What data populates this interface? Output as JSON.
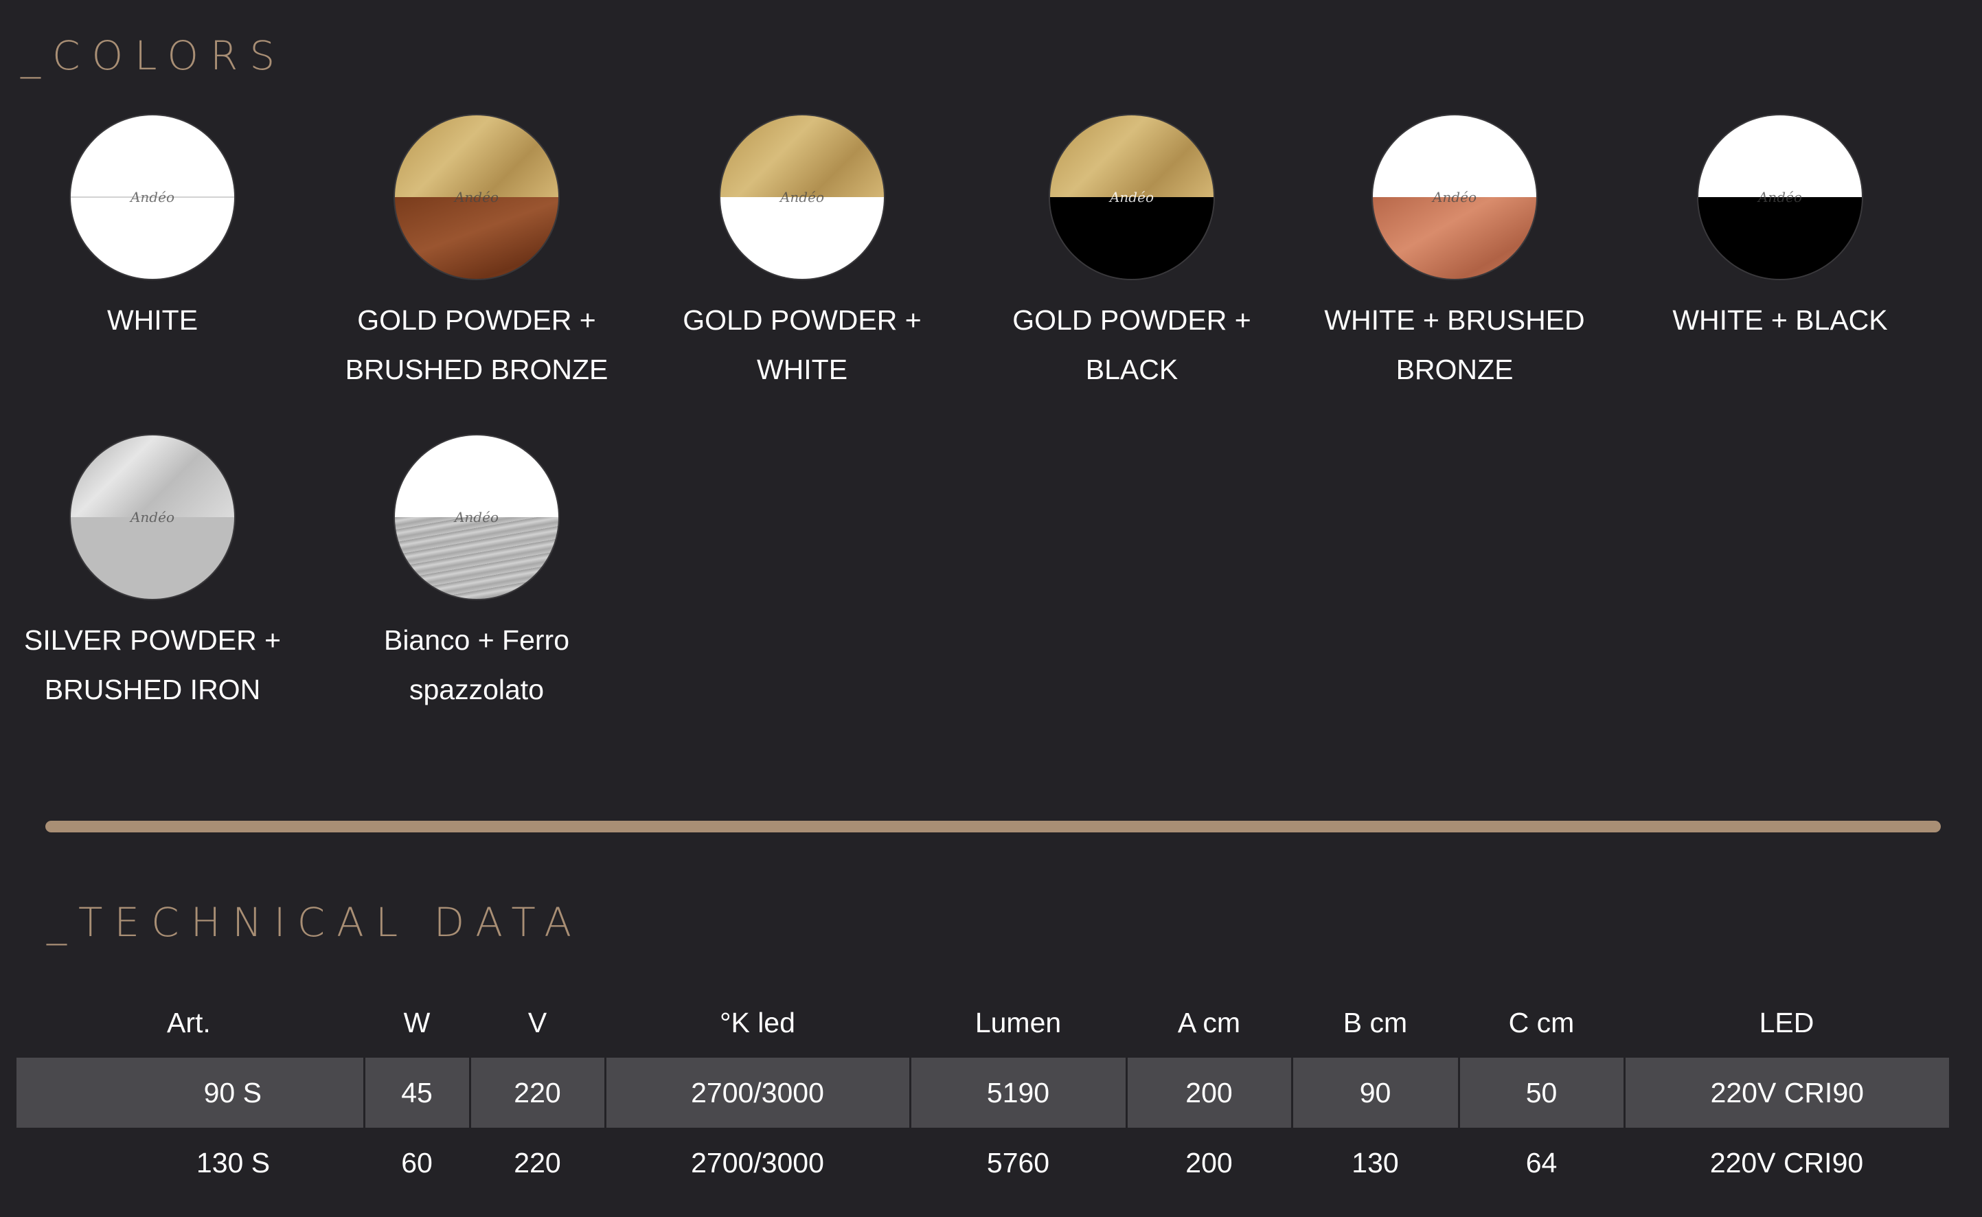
{
  "colors_section": {
    "title": "_COLORS",
    "swatches": [
      {
        "label": "WHITE",
        "brand": "Andéo",
        "top_color": "#ffffff",
        "bottom_color": "#ffffff"
      },
      {
        "label": "GOLD POWDER +\nBRUSHED BRONZE",
        "brand": "Andéo",
        "top_color": "#c8a866",
        "bottom_color": "#8a4a28"
      },
      {
        "label": "GOLD POWDER +\nWHITE",
        "brand": "Andéo",
        "top_color": "#c8a866",
        "bottom_color": "#ffffff"
      },
      {
        "label": "GOLD POWDER +\nBLACK",
        "brand": "Andéo",
        "top_color": "#c8a866",
        "bottom_color": "#000000"
      },
      {
        "label": "WHITE + BRUSHED\nBRONZE",
        "brand": "Andéo",
        "top_color": "#ffffff",
        "bottom_color": "#c8785a"
      },
      {
        "label": "WHITE +  BLACK",
        "brand": "Andéo",
        "top_color": "#ffffff",
        "bottom_color": "#000000"
      },
      {
        "label": "SILVER POWDER +\nBRUSHED IRON",
        "brand": "Andéo",
        "top_color": "#d0d0d0",
        "bottom_color": "#bdbdbd"
      },
      {
        "label": "Bianco + Ferro\nspazzolato",
        "brand": "Andéo",
        "top_color": "#ffffff",
        "bottom_color": "#b5b5b5"
      }
    ]
  },
  "technical_section": {
    "title": "_TECHNICAL DATA",
    "headers": [
      "Art.",
      "W",
      "V",
      "°K led",
      "Lumen",
      "A cm",
      "B cm",
      "C cm",
      "LED"
    ],
    "rows": [
      [
        "90 S",
        "45",
        "220",
        "2700/3000",
        "5190",
        "200",
        "90",
        "50",
        "220V CRI90"
      ],
      [
        "130 S",
        "60",
        "220",
        "2700/3000",
        "5760",
        "200",
        "130",
        "64",
        "220V CRI90"
      ]
    ]
  },
  "accent_color": "#a98f75",
  "background_color": "#232226"
}
